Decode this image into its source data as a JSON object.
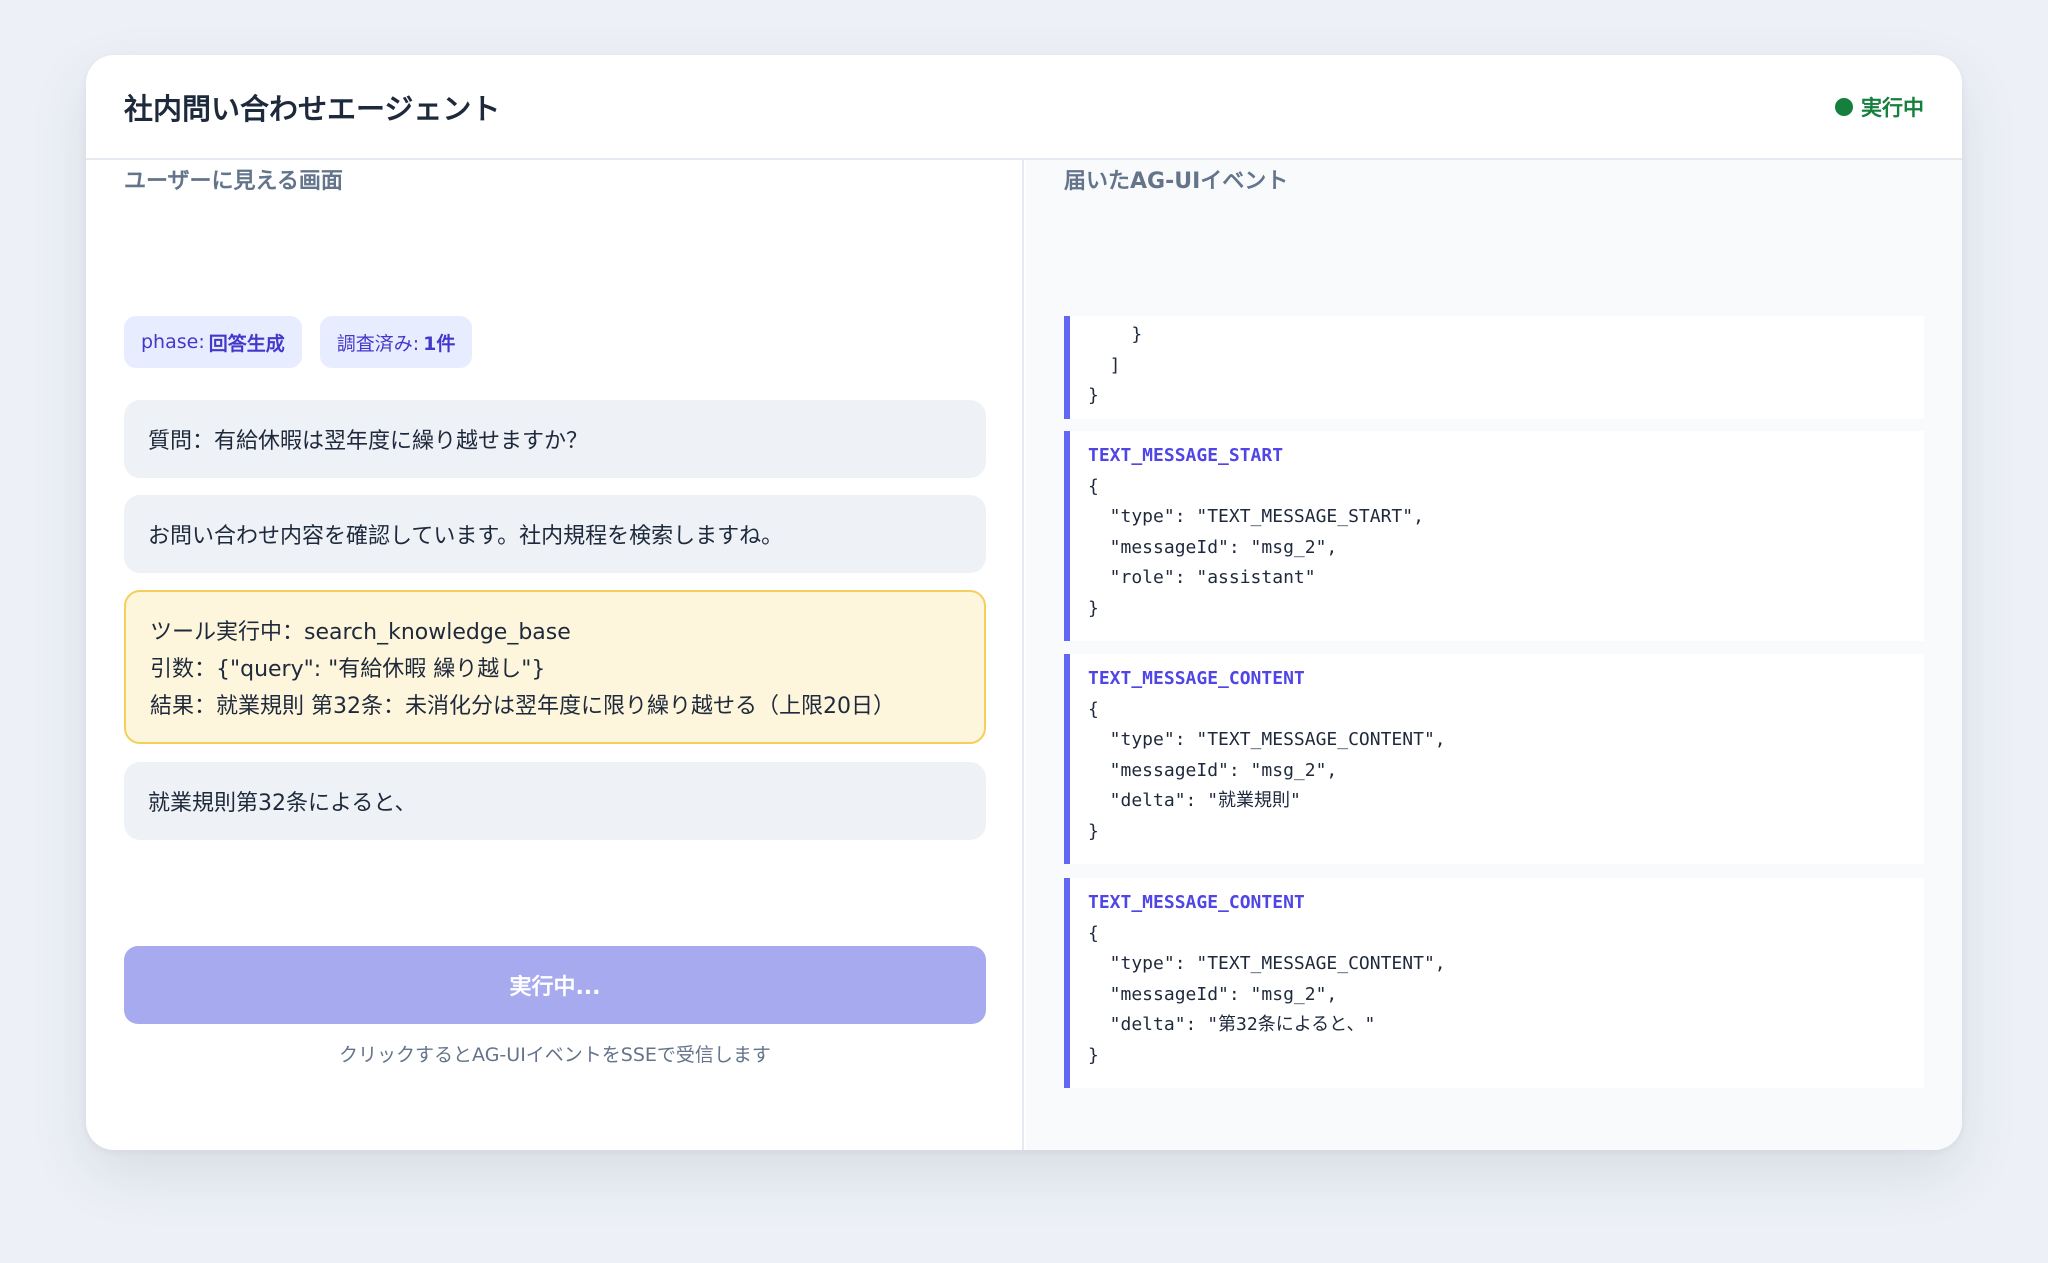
{
  "header": {
    "title": "社内問い合わせエージェント",
    "status": "実行中",
    "status_color": "#15803d"
  },
  "left": {
    "section_title": "ユーザーに見える画面",
    "chips": [
      {
        "label": "phase:",
        "value": "回答生成"
      },
      {
        "label": "調査済み:",
        "value": "1件"
      }
    ],
    "question": "質問：有給休暇は翌年度に繰り越せますか？",
    "assistant_intro": "お問い合わせ内容を確認しています。社内規程を検索しますね。",
    "tool": {
      "running": "ツール実行中：search_knowledge_base",
      "args": "引数：{\"query\": \"有給休暇 繰り越し\"}",
      "result": "結果：就業規則 第32条：未消化分は翌年度に限り繰り越せる（上限20日）"
    },
    "assistant_answer": "就業規則第32条によると、",
    "run_button": "実行中...",
    "hint": "クリックするとAG-UIイベントをSSEで受信します"
  },
  "right": {
    "section_title": "届いたAG-UIイベント",
    "events": [
      {
        "name": "",
        "body": "    }\n  ]\n}"
      },
      {
        "name": "TEXT_MESSAGE_START",
        "body": "{\n  \"type\": \"TEXT_MESSAGE_START\",\n  \"messageId\": \"msg_2\",\n  \"role\": \"assistant\"\n}"
      },
      {
        "name": "TEXT_MESSAGE_CONTENT",
        "body": "{\n  \"type\": \"TEXT_MESSAGE_CONTENT\",\n  \"messageId\": \"msg_2\",\n  \"delta\": \"就業規則\"\n}"
      },
      {
        "name": "TEXT_MESSAGE_CONTENT",
        "body": "{\n  \"type\": \"TEXT_MESSAGE_CONTENT\",\n  \"messageId\": \"msg_2\",\n  \"delta\": \"第32条によると、\"\n}"
      }
    ]
  },
  "colors": {
    "accent": "#6366f1",
    "button_disabled": "#a7aaee",
    "tool_bg": "#fef6dc",
    "tool_border": "#f4cf5c"
  }
}
